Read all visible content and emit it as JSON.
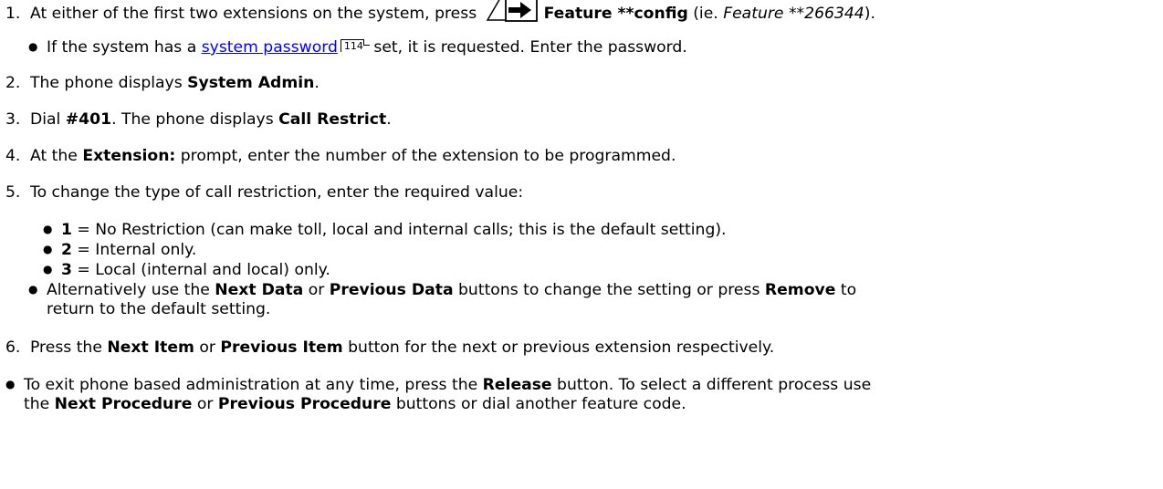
{
  "steps": {
    "s1": {
      "num": "1.",
      "prefix": "At either of the first two extensions on the system, press",
      "icon": "feature-button-icon",
      "bold": "Feature **config",
      "paren_open": " (ie. ",
      "italic": "Feature **266344",
      "paren_close": ")."
    },
    "s1_sub": {
      "prefix": "If the system has a ",
      "link": "system password",
      "page_ref": "114",
      "suffix": " set, it is requested. Enter the password."
    },
    "s2": {
      "num": "2.",
      "prefix": "The phone displays ",
      "bold": "System Admin",
      "suffix": "."
    },
    "s3": {
      "num": "3.",
      "prefix": "Dial ",
      "bold1": "#401",
      "middle": ". The phone displays ",
      "bold2": "Call Restrict",
      "suffix": "."
    },
    "s4": {
      "num": "4.",
      "prefix": "At the ",
      "bold": "Extension:",
      "suffix": " prompt, enter the number of the extension to be programmed."
    },
    "s5": {
      "num": "5.",
      "text": "To change the type of call restriction, enter the required value:",
      "options": [
        {
          "key": "1",
          "text": " = No Restriction (can make toll, local and internal calls; this is the default setting)."
        },
        {
          "key": "2",
          "text": " = Internal only."
        },
        {
          "key": "3",
          "text": " = Local (internal and local) only."
        }
      ],
      "alt": {
        "prefix": "Alternatively use the ",
        "bold1": "Next Data",
        "mid1": " or ",
        "bold2": "Previous Data",
        "mid2": " buttons to change the setting or press ",
        "bold3": "Remove",
        "mid3": " to",
        "line2": "return to the default setting."
      }
    },
    "s6": {
      "num": "6.",
      "prefix": "Press the ",
      "bold1": "Next Item",
      "mid": " or ",
      "bold2": "Previous Item",
      "suffix": " button for the next or previous extension respectively."
    }
  },
  "footer": {
    "prefix": "To exit phone based administration at any time, press the ",
    "bold1": "Release",
    "mid1": " button. To select a different process use",
    "line2_prefix": "the ",
    "bold2": "Next Procedure",
    "mid2": " or ",
    "bold3": "Previous Procedure",
    "suffix": " buttons or dial another feature code."
  }
}
